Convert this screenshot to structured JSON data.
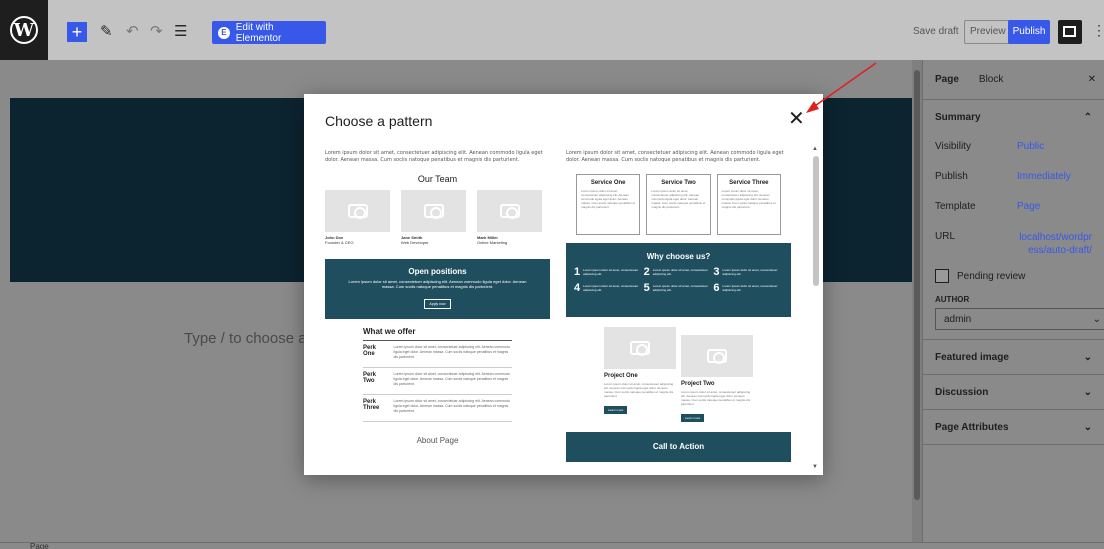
{
  "topbar": {
    "elementor_label": "Edit with Elementor",
    "save_draft": "Save draft",
    "preview": "Preview",
    "publish": "Publish"
  },
  "editor": {
    "placeholder": "Type / to choose a b"
  },
  "sidebar": {
    "tabs": [
      "Page",
      "Block"
    ],
    "summary": "Summary",
    "rows": [
      {
        "k": "Visibility",
        "v": "Public"
      },
      {
        "k": "Publish",
        "v": "Immediately"
      },
      {
        "k": "Template",
        "v": "Page"
      },
      {
        "k": "URL",
        "v": "localhost/wordpress/auto-draft/"
      }
    ],
    "pending": "Pending review",
    "author_label": "AUTHOR",
    "author_value": "admin",
    "sections": [
      "Featured image",
      "Discussion",
      "Page Attributes"
    ]
  },
  "statusbar": "Page",
  "modal": {
    "title": "Choose a pattern",
    "lorem": "Lorem ipsum dolor sit amet, consectetuer adipiscing elit. Aenean commodo ligula eget dolor. Aenean massa. Cum sociis natoque penatibus et magnis dis parturient.",
    "left": {
      "team_heading": "Our Team",
      "team": [
        {
          "name": "John Doe",
          "role": "Founder & CEO"
        },
        {
          "name": "Jane Smith",
          "role": "Web Developer"
        },
        {
          "name": "Mark Miller",
          "role": "Online Marketing"
        }
      ],
      "open_title": "Open positions",
      "open_desc": "Lorem ipsum dolor sit amet, consectetuer adipiscing elit. Aenean commodo ligula eget dolor. Aenean massa. Cum sociis natoque penatibus et magnis dis parturient.",
      "open_button": "Apply now",
      "offer_title": "What we offer",
      "perks": [
        "Perk One",
        "Perk Two",
        "Perk Three"
      ],
      "perk_desc": "Lorem ipsum dolor sit amet, consectetuer adipiscing elit. Aenean commodo ligula eget dolor. Aenean massa. Cum sociis natoque penatibus et magnis dis parturient.",
      "about": "About Page"
    },
    "right": {
      "services": [
        "Service One",
        "Service Two",
        "Service Three"
      ],
      "service_desc": "Lorem ipsum dolor sit amet, consectetuer adipiscing elit. Aenean commodo ligula eget dolor. Aenean massa. Cum sociis natoque penatibus et magnis dis parturient.",
      "why_title": "Why choose us?",
      "why_items": [
        {
          "n": "1",
          "t": "Lorem ipsum dolor sit amet, consectetuer adipiscing elit."
        },
        {
          "n": "2",
          "t": "Lorem ipsum dolor sit amet, consectetuer adipiscing elit."
        },
        {
          "n": "3",
          "t": "Lorem ipsum dolor sit amet, consectetuer adipiscing elit."
        },
        {
          "n": "4",
          "t": "Lorem ipsum dolor sit amet, consectetuer adipiscing elit."
        },
        {
          "n": "5",
          "t": "Lorem ipsum dolor sit amet, consectetuer adipiscing elit."
        },
        {
          "n": "6",
          "t": "Lorem ipsum dolor sit amet, consectetuer adipiscing elit."
        }
      ],
      "projects": [
        {
          "title": "Project One",
          "button": "Learn more"
        },
        {
          "title": "Project Two",
          "button": "Learn more"
        }
      ],
      "project_desc": "Lorem ipsum dolor sit amet, consectetuer adipiscing elit. Aenean commodo ligula eget dolor. Aenean massa. Cum sociis natoque penatibus et magnis dis parturient.",
      "cta": "Call to Action"
    }
  },
  "colors": {
    "accent": "#3858e9",
    "pattern_dark": "#1f4f5e",
    "arrow": "#e02020"
  }
}
